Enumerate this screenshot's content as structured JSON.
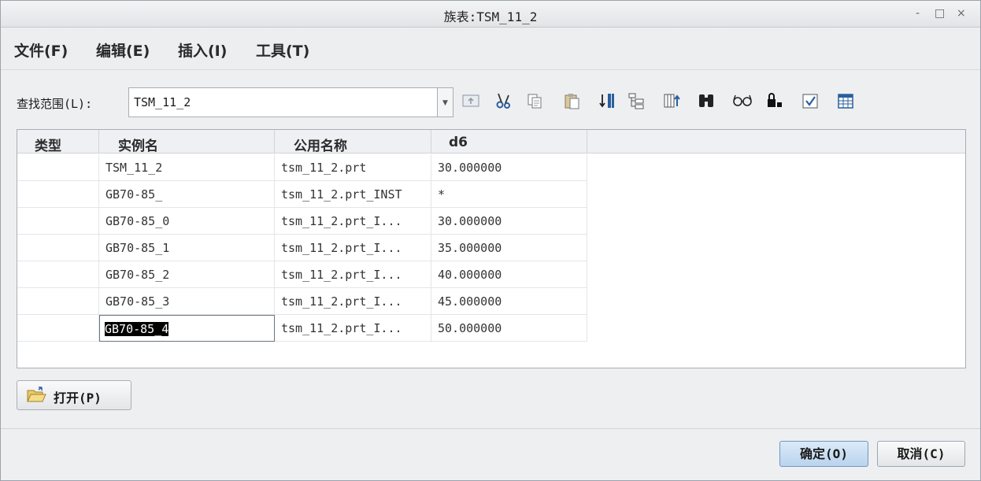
{
  "window": {
    "title": "族表:TSM_11_2",
    "controls": [
      "-",
      "□",
      "×"
    ]
  },
  "menubar": {
    "items": [
      "文件(F)",
      "编辑(E)",
      "插入(I)",
      "工具(T)"
    ]
  },
  "lookin": {
    "label": "查找范围(L):",
    "value": "TSM_11_2"
  },
  "toolbar": {
    "icons": [
      "folder-up-icon",
      "cut-icon",
      "copy-icon",
      "paste-icon",
      "insert-column-icon",
      "tree-icon",
      "add-column-icon",
      "find-icon",
      "preview-icon",
      "lock-icon",
      "verify-icon",
      "table-icon"
    ]
  },
  "table": {
    "columns": [
      "类型",
      "实例名",
      "公用名称",
      "d6"
    ],
    "rows": [
      {
        "type": "",
        "name": "TSM_11_2",
        "common": "tsm_11_2.prt",
        "d6": "30.000000"
      },
      {
        "type": "",
        "name": "GB70-85_",
        "common": "tsm_11_2.prt_INST",
        "d6": "*"
      },
      {
        "type": "",
        "name": "GB70-85_0",
        "common": "tsm_11_2.prt_I...",
        "d6": "30.000000"
      },
      {
        "type": "",
        "name": "GB70-85_1",
        "common": "tsm_11_2.prt_I...",
        "d6": "35.000000"
      },
      {
        "type": "",
        "name": "GB70-85_2",
        "common": "tsm_11_2.prt_I...",
        "d6": "40.000000"
      },
      {
        "type": "",
        "name": "GB70-85_3",
        "common": "tsm_11_2.prt_I...",
        "d6": "45.000000"
      },
      {
        "type": "",
        "name": "GB70-85_4",
        "common": "tsm_11_2.prt_I...",
        "d6": "50.000000"
      }
    ]
  },
  "buttons": {
    "open": "打开(P)",
    "ok": "确定(O)",
    "cancel": "取消(C)"
  }
}
